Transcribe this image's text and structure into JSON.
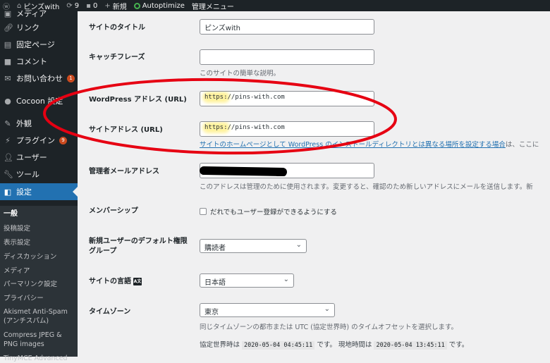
{
  "adminbar": {
    "site_name": "ピンズwith",
    "updates_count": "9",
    "comments_count": "0",
    "new_label": "新規",
    "autoptimize_label": "Autoptimize",
    "admin_menu_label": "管理メニュー",
    "colors": {
      "background": "#1d2327",
      "autoptimize_status": "#46b450"
    }
  },
  "sidebar": {
    "top_partial_label": "メディア",
    "items": [
      {
        "label": "リンク",
        "icon": "link-icon"
      },
      {
        "label": "固定ページ",
        "icon": "page-icon"
      },
      {
        "label": "コメント",
        "icon": "comment-icon"
      },
      {
        "label": "お問い合わせ",
        "icon": "mail-icon",
        "badge": "1"
      },
      {
        "label": "Cocoon 設定",
        "icon": "cocoon-icon"
      },
      {
        "label": "外観",
        "icon": "brush-icon"
      },
      {
        "label": "プラグイン",
        "icon": "plugin-icon",
        "badge": "9"
      },
      {
        "label": "ユーザー",
        "icon": "user-icon"
      },
      {
        "label": "ツール",
        "icon": "wrench-icon"
      },
      {
        "label": "設定",
        "icon": "settings-icon",
        "current": true
      }
    ],
    "submenu": [
      "一般",
      "投稿設定",
      "表示設定",
      "ディスカッション",
      "メディア",
      "パーマリンク設定",
      "プライバシー",
      "Akismet Anti-Spam (アンチスパム)",
      "Compress JPEG & PNG images",
      "TinyMCE Advanced"
    ],
    "colors": {
      "current": "#2271b1",
      "submenu_bg": "#2c3338"
    }
  },
  "form": {
    "site_title": {
      "label": "サイトのタイトル",
      "value": "ピンズwith"
    },
    "tagline": {
      "label": "キャッチフレーズ",
      "value": "",
      "description": "このサイトの簡単な説明。"
    },
    "wp_address": {
      "label": "WordPress アドレス (URL)",
      "scheme": "https:",
      "rest": "//pins-with.com"
    },
    "site_address": {
      "label": "サイトアドレス (URL)",
      "scheme": "https:",
      "rest": "//pins-with.com",
      "description_link": "サイトのホームページとして WordPress のインストールディレクトリとは異なる場所を設定する場合",
      "description_tail": "は、ここに"
    },
    "admin_email": {
      "label": "管理者メールアドレス",
      "description": "このアドレスは管理のために使用されます。変更すると、確認のため新しいアドレスにメールを送信します。新"
    },
    "membership": {
      "label": "メンバーシップ",
      "checkbox_label": "だれでもユーザー登録ができるようにする",
      "checked": false
    },
    "default_role": {
      "label_line1": "新規ユーザーのデフォルト権限",
      "label_line2": "グループ",
      "value": "購読者"
    },
    "site_language": {
      "label": "サイトの言語",
      "value": "日本語",
      "icon_text": "A文"
    },
    "timezone": {
      "label": "タイムゾーン",
      "value": "東京",
      "description": "同じタイムゾーンの都市または UTC (協定世界時) のタイムオフセットを選択します。",
      "utc_prefix": "協定世界時は",
      "utc_time": "2020-05-04 04:45:11",
      "utc_suffix": "です。",
      "local_prefix": "現地時間は",
      "local_time": "2020-05-04 13:45:11",
      "local_suffix": "です。"
    }
  },
  "annotation": {
    "ellipse_color": "#e60012",
    "highlight_color": "#fff3a0"
  }
}
